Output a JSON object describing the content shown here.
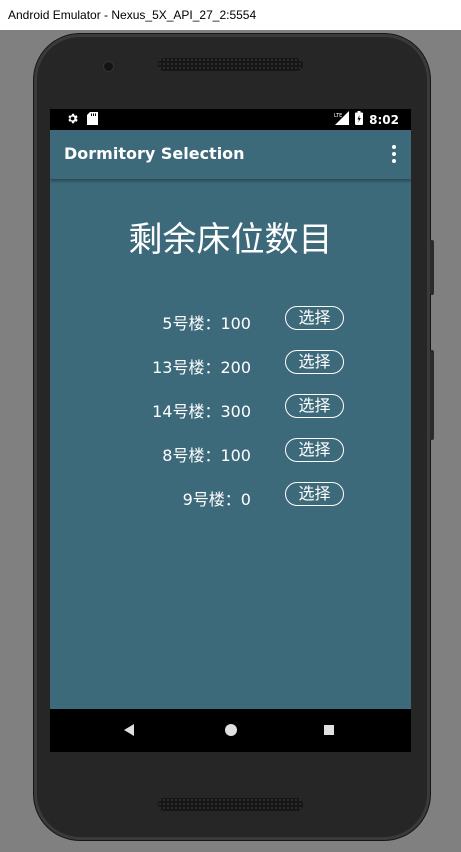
{
  "window": {
    "title": "Android Emulator - Nexus_5X_API_27_2:5554"
  },
  "status_bar": {
    "time": "8:02",
    "left_icons": [
      "gear-icon",
      "sd-card-icon"
    ],
    "right_icons": [
      "signal-lte-icon",
      "battery-icon"
    ]
  },
  "app_bar": {
    "title": "Dormitory Selection",
    "menu_icon": "overflow-menu-icon"
  },
  "main": {
    "heading": "剩余床位数目",
    "rows": [
      {
        "label": "5号楼：100",
        "button": "选择"
      },
      {
        "label": "13号楼：200",
        "button": "选择"
      },
      {
        "label": "14号楼：300",
        "button": "选择"
      },
      {
        "label": "8号楼：100",
        "button": "选择"
      },
      {
        "label": "9号楼：0",
        "button": "选择"
      }
    ]
  },
  "nav_bar": {
    "icons": [
      "back-icon",
      "home-icon",
      "recents-icon"
    ]
  },
  "colors": {
    "primary": "#3d6a7b",
    "status_bar": "#000000",
    "phone_frame": "#262626"
  }
}
